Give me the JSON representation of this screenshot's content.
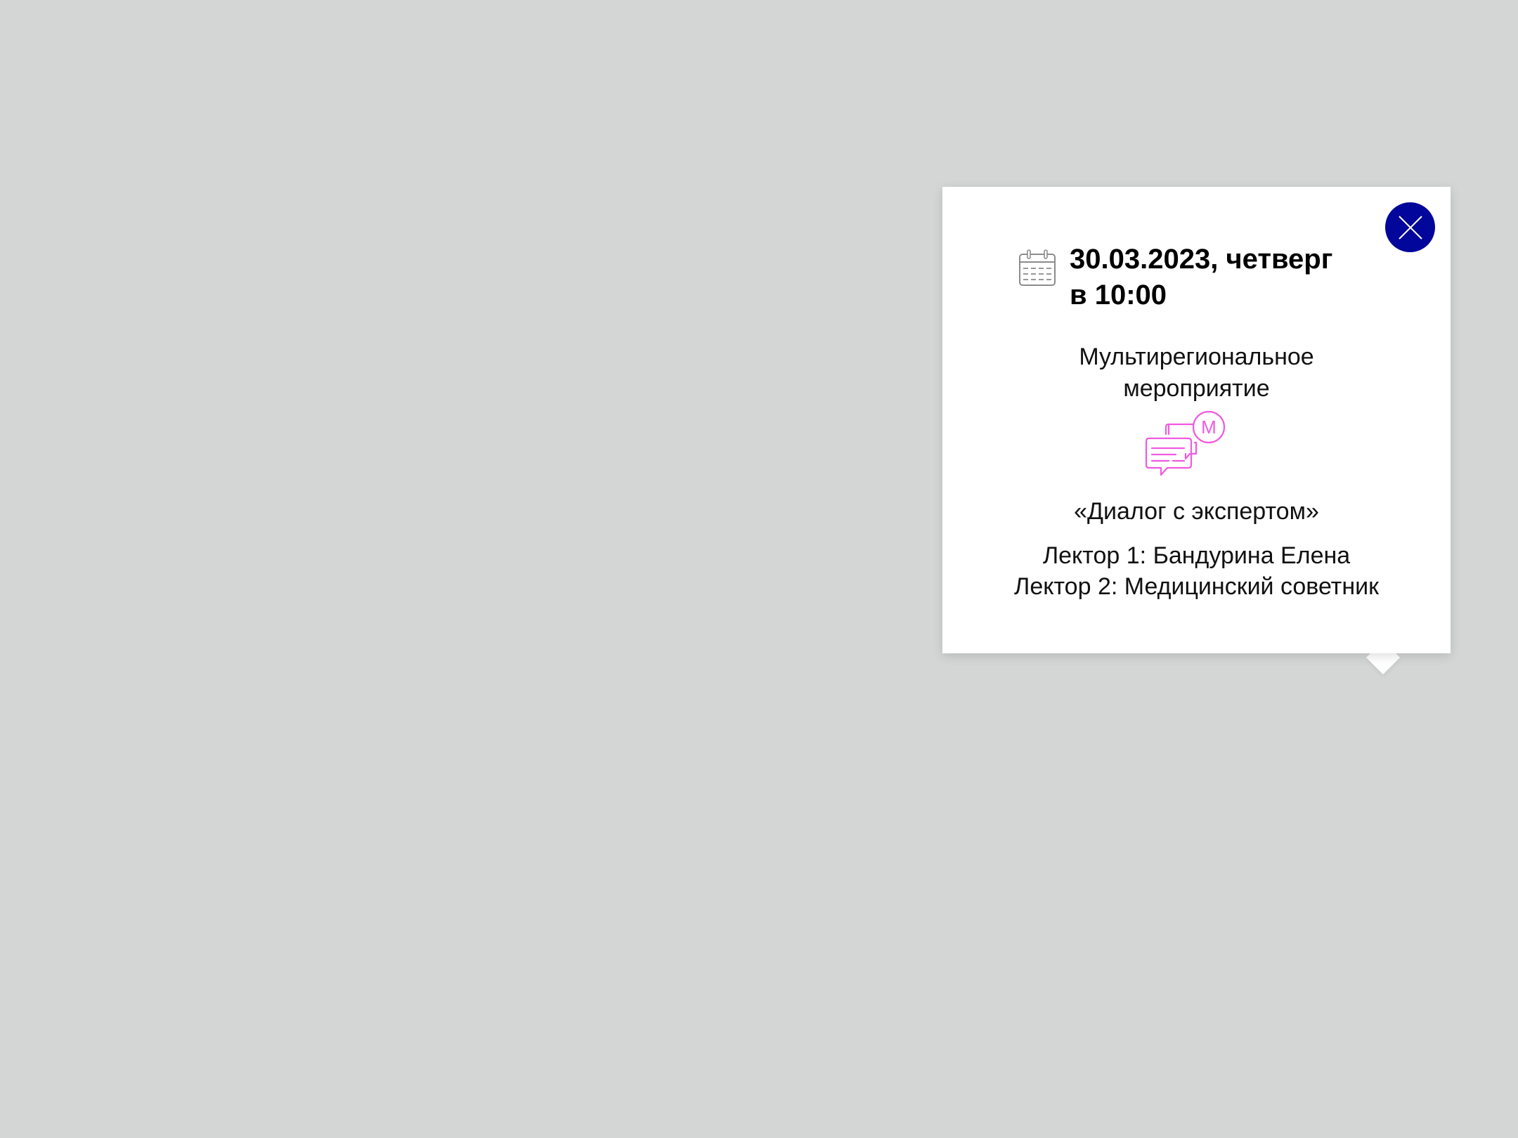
{
  "page": {
    "background_color": "#d4d6d6"
  },
  "popup": {
    "close_button": {
      "icon": "close-icon",
      "color": "#02069a"
    },
    "date": {
      "icon": "calendar-icon",
      "line1": "30.03.2023, четверг",
      "line2": "в 10:00"
    },
    "event_type": {
      "line1": "Мультирегиональное",
      "line2": "мероприятие"
    },
    "event_icon": {
      "name": "dialog-icon",
      "letter": "M",
      "color": "#f05ae0"
    },
    "event_title": "«Диалог с экспертом»",
    "lecturers": [
      "Лектор 1: Бандурина Елена",
      "Лектор 2: Медицинский советник"
    ]
  }
}
